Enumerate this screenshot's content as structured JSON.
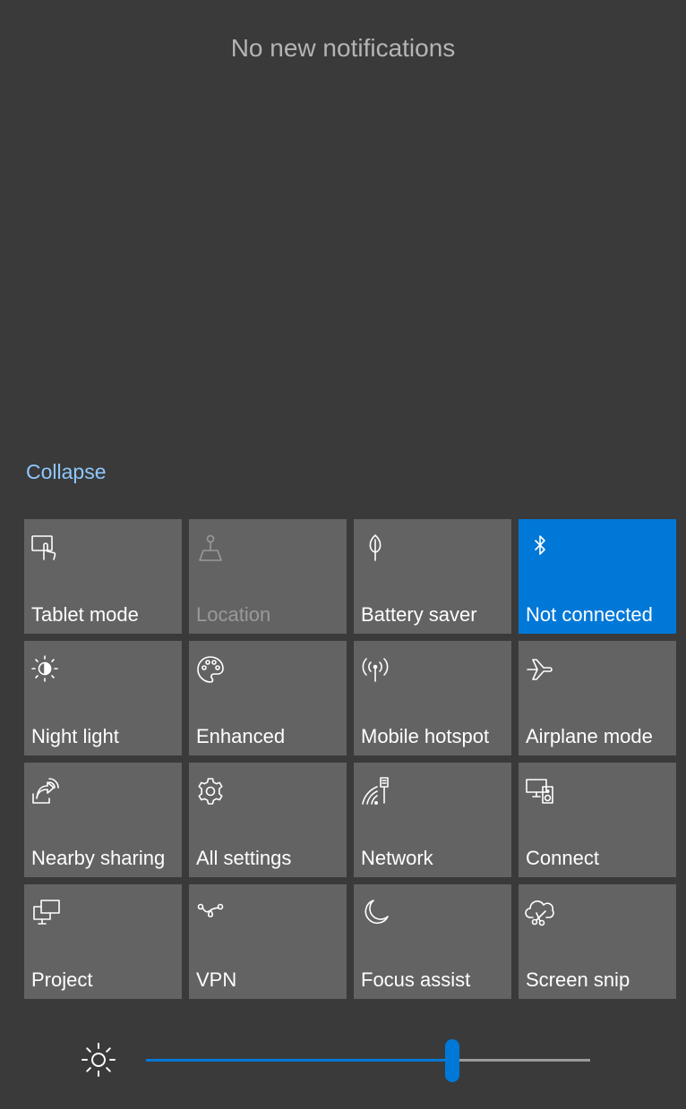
{
  "notifications": {
    "empty_text": "No new notifications",
    "collapse_label": "Collapse"
  },
  "colors": {
    "background": "#3a3a3a",
    "tile": "#636363",
    "accent": "#0078d7",
    "link": "#8ec8ff"
  },
  "quick_actions": [
    {
      "label": "Tablet mode",
      "icon": "tablet-mode-icon",
      "state": "off"
    },
    {
      "label": "Location",
      "icon": "location-icon",
      "state": "disabled"
    },
    {
      "label": "Battery saver",
      "icon": "battery-saver-icon",
      "state": "off"
    },
    {
      "label": "Not connected",
      "icon": "bluetooth-icon",
      "state": "on"
    },
    {
      "label": "Night light",
      "icon": "night-light-icon",
      "state": "off"
    },
    {
      "label": "Enhanced",
      "icon": "palette-icon",
      "state": "off"
    },
    {
      "label": "Mobile hotspot",
      "icon": "mobile-hotspot-icon",
      "state": "off"
    },
    {
      "label": "Airplane mode",
      "icon": "airplane-icon",
      "state": "off"
    },
    {
      "label": "Nearby sharing",
      "icon": "nearby-sharing-icon",
      "state": "off"
    },
    {
      "label": "All settings",
      "icon": "gear-icon",
      "state": "off"
    },
    {
      "label": "Network",
      "icon": "network-icon",
      "state": "off"
    },
    {
      "label": "Connect",
      "icon": "connect-icon",
      "state": "off"
    },
    {
      "label": "Project",
      "icon": "project-icon",
      "state": "off"
    },
    {
      "label": "VPN",
      "icon": "vpn-icon",
      "state": "off"
    },
    {
      "label": "Focus assist",
      "icon": "moon-icon",
      "state": "off"
    },
    {
      "label": "Screen snip",
      "icon": "screen-snip-icon",
      "state": "off"
    }
  ],
  "brightness": {
    "icon": "brightness-icon",
    "value_percent": 69
  }
}
